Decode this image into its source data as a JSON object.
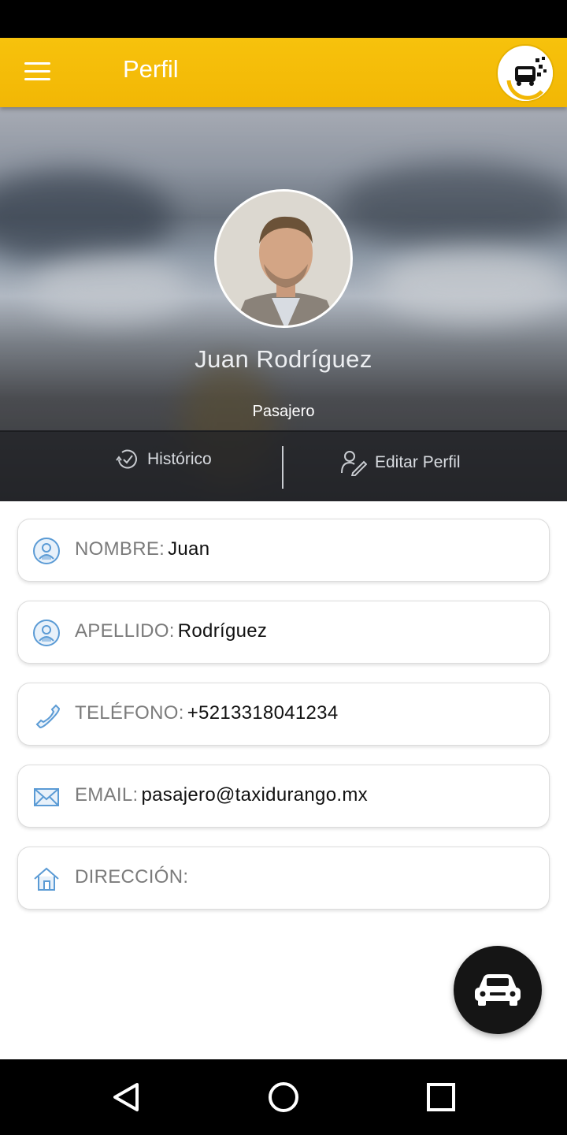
{
  "app_bar": {
    "title": "Perfil"
  },
  "profile": {
    "name": "Juan Rodríguez",
    "role": "Pasajero"
  },
  "actions": {
    "historico": "Histórico",
    "editar": "Editar Perfil"
  },
  "fields": [
    {
      "icon": "user-badge-icon",
      "label": "NOMBRE:",
      "value": "Juan"
    },
    {
      "icon": "user-badge-icon",
      "label": "APELLIDO:",
      "value": "Rodríguez"
    },
    {
      "icon": "phone-icon",
      "label": "TELÉFONO:",
      "value": "+5213318041234"
    },
    {
      "icon": "envelope-icon",
      "label": "EMAIL:",
      "value": "pasajero@taxidurango.mx"
    },
    {
      "icon": "home-icon",
      "label": "DIRECCIÓN:",
      "value": ""
    }
  ],
  "fab": {
    "icon": "car-icon"
  },
  "colors": {
    "accent": "#f2b705",
    "icon_blue": "#5b9bd5",
    "fab": "#151515"
  }
}
